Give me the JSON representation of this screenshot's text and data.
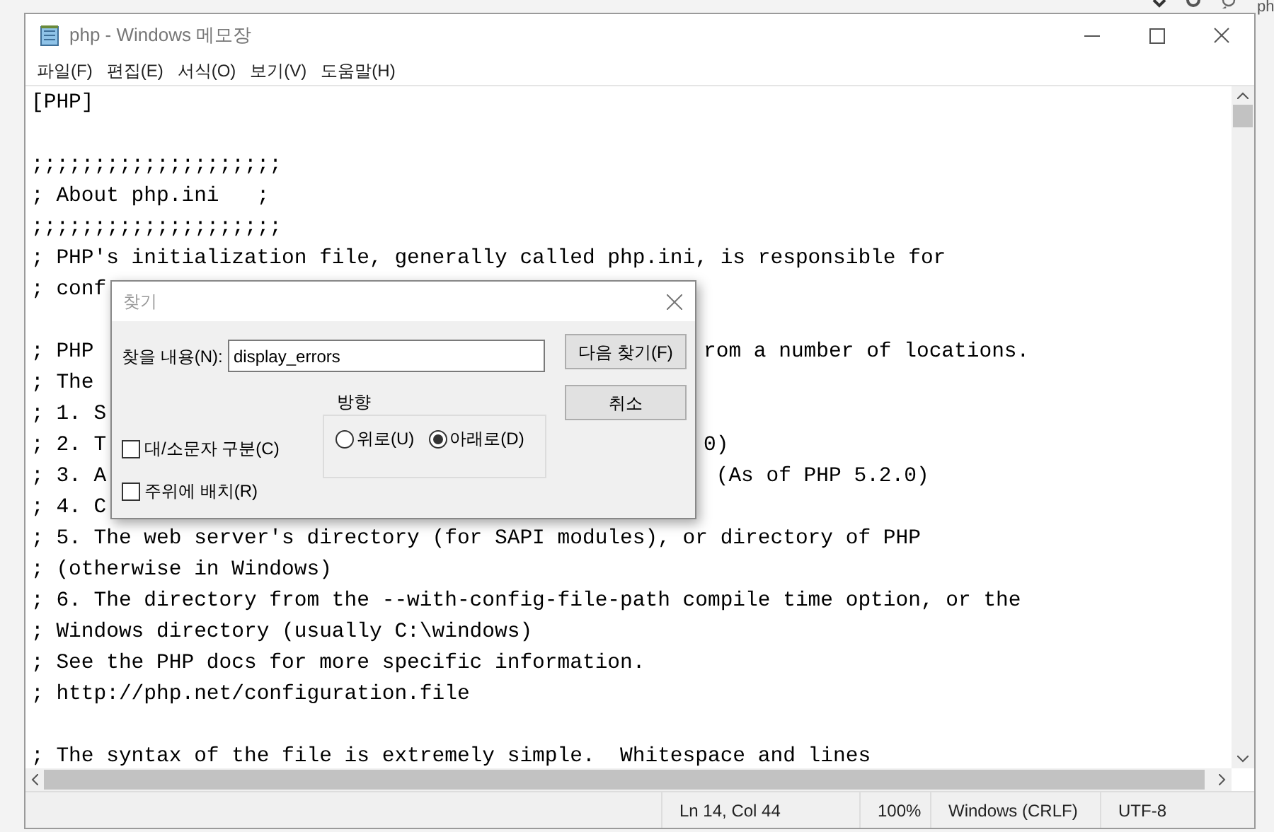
{
  "background_window": {
    "search_text": "ph"
  },
  "window": {
    "title": "php - Windows 메모장"
  },
  "menu": [
    "파일(F)",
    "편집(E)",
    "서식(O)",
    "보기(V)",
    "도움말(H)"
  ],
  "editor": {
    "lines": [
      {
        "left": "[PHP]"
      },
      {
        "kind": "blank"
      },
      {
        "left": ";;;;;;;;;;;;;;;;;;;;"
      },
      {
        "left": "; About php.ini   ;"
      },
      {
        "left": ";;;;;;;;;;;;;;;;;;;;"
      },
      {
        "left": "; PHP's initialization file, generally called php.ini, is responsible for"
      },
      {
        "left": "; conf"
      },
      {
        "kind": "blank"
      },
      {
        "left": "; PHP",
        "right": "rom a number of locations."
      },
      {
        "left": "; The"
      },
      {
        "left": "; 1. S"
      },
      {
        "left": "; 2. T",
        "right": "0)"
      },
      {
        "left": "; 3. A",
        "right": " (As of PHP 5.2.0)"
      },
      {
        "left": "; 4. C"
      },
      {
        "left": "; 5. The web server's directory (for SAPI modules), or directory of PHP"
      },
      {
        "left": "; (otherwise in Windows)"
      },
      {
        "left": "; 6. The directory from the --with-config-file-path compile time option, or the"
      },
      {
        "left": "; Windows directory (usually C:\\windows)"
      },
      {
        "left": "; See the PHP docs for more specific information."
      },
      {
        "left": "; http://php.net/configuration.file"
      },
      {
        "kind": "blank"
      },
      {
        "left": "; The syntax of the file is extremely simple.  Whitespace and lines"
      }
    ]
  },
  "status_bar": [
    "Ln 14, Col 44",
    "100%",
    "Windows (CRLF)",
    "UTF-8"
  ],
  "find_dialog": {
    "title": "찾기",
    "find_label": "찾을 내용(N):",
    "find_value": "display_errors",
    "buttons": [
      "다음 찾기(F)",
      "취소"
    ],
    "direction": {
      "label": "방향",
      "options": [
        {
          "label": "위로(U)",
          "selected": false
        },
        {
          "label": "아래로(D)",
          "selected": true
        }
      ]
    },
    "options": [
      {
        "label": "대/소문자 구분(C)",
        "checked": false
      },
      {
        "label": "주위에 배치(R)",
        "checked": false
      }
    ]
  }
}
